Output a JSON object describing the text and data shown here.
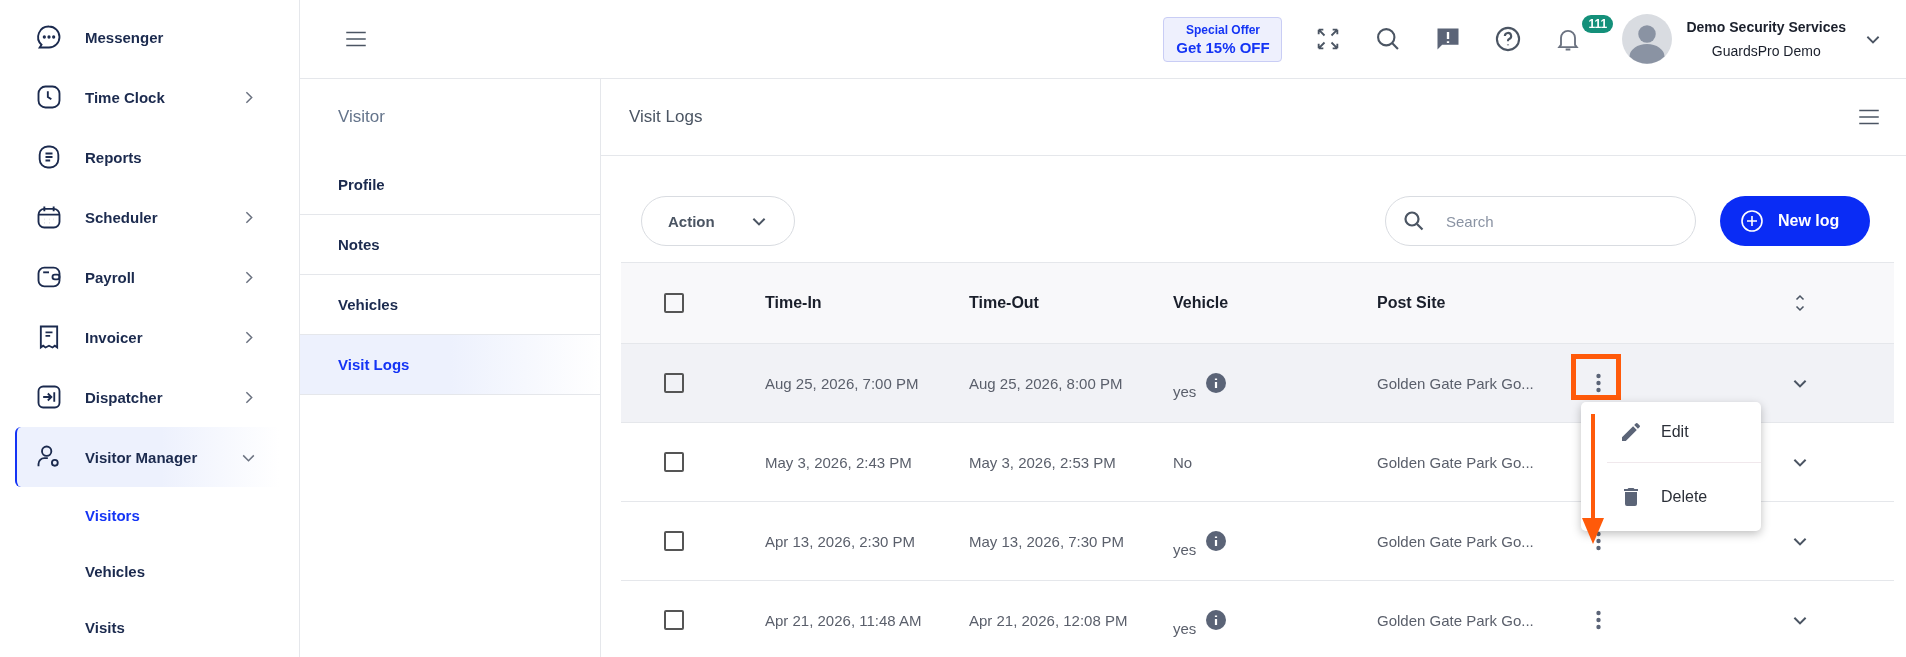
{
  "sidebar": {
    "items": [
      {
        "label": "Messenger",
        "selected": false
      },
      {
        "label": "Time Clock",
        "expanded": false,
        "selected": false
      },
      {
        "label": "Reports",
        "selected": false
      },
      {
        "label": "Scheduler",
        "expanded": false,
        "selected": false
      },
      {
        "label": "Payroll",
        "expanded": false,
        "selected": false
      },
      {
        "label": "Invoicer",
        "expanded": false,
        "selected": false
      },
      {
        "label": "Dispatcher",
        "expanded": false,
        "selected": false
      },
      {
        "label": "Visitor Manager",
        "expanded": true,
        "selected": true,
        "children": [
          {
            "label": "Visitors",
            "selected": true
          },
          {
            "label": "Vehicles",
            "selected": false
          },
          {
            "label": "Visits",
            "selected": false
          }
        ]
      }
    ]
  },
  "topbar": {
    "offer": {
      "line_1": "Special Offer",
      "line_2": "Get 15% OFF"
    },
    "notifications": "111",
    "user": {
      "name": "Demo Security Services",
      "company": "GuardsPro Demo"
    }
  },
  "subnav": {
    "title": "Visitor",
    "items": [
      {
        "label": "Profile",
        "selected": false
      },
      {
        "label": "Notes",
        "selected": false
      },
      {
        "label": "Vehicles",
        "selected": false
      },
      {
        "label": "Visit Logs",
        "selected": true
      }
    ]
  },
  "content": {
    "title": "Visit Logs",
    "action": "Action",
    "search": {
      "placeholder": "Search"
    },
    "new_button": "New log"
  },
  "table": {
    "all_checked": false,
    "columns": [
      "Time-In",
      "Time-Out",
      "Vehicle",
      "Post Site"
    ],
    "rows": [
      {
        "checked": false,
        "highlighted": true,
        "time_in": "Aug 25, 2026, 7:00 PM",
        "time_out": "Aug 25, 2026, 8:00 PM",
        "vehicle": "yes",
        "vehicle_info": true,
        "post_site": "Golden Gate Park Go..."
      },
      {
        "checked": false,
        "highlighted": false,
        "time_in": "May 3, 2026, 2:43 PM",
        "time_out": "May 3, 2026, 2:53 PM",
        "vehicle": "No",
        "vehicle_info": false,
        "post_site": "Golden Gate Park Go..."
      },
      {
        "checked": false,
        "highlighted": false,
        "time_in": "Apr 13, 2026, 2:30 PM",
        "time_out": "May 13, 2026, 7:30 PM",
        "vehicle": "yes",
        "vehicle_info": true,
        "post_site": "Golden Gate Park Go..."
      },
      {
        "checked": false,
        "highlighted": false,
        "time_in": "Apr 21, 2026, 11:48 AM",
        "time_out": "Apr 21, 2026, 12:08 PM",
        "vehicle": "yes",
        "vehicle_info": true,
        "post_site": "Golden Gate Park Go..."
      }
    ],
    "row_menu": {
      "open": true,
      "items": [
        {
          "kind": "edit",
          "label": "Edit"
        },
        {
          "kind": "delete",
          "label": "Delete"
        }
      ]
    }
  }
}
